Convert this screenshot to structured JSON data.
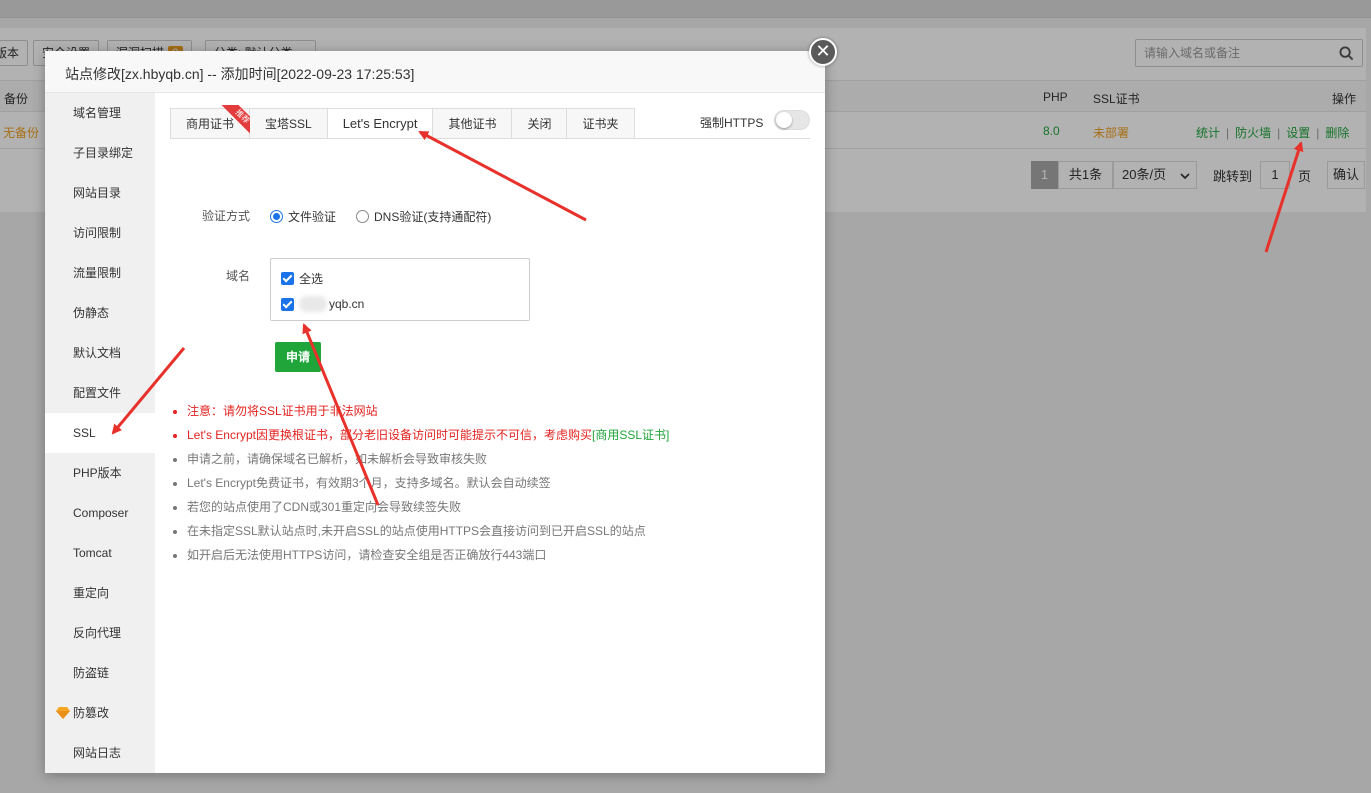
{
  "background": {
    "toolbar_buttons": [
      "版本",
      "安全设置",
      "漏洞扫描",
      "分类: 默认分类"
    ],
    "toolbar_badge": "0",
    "search_placeholder": "请输入域名或备注",
    "table": {
      "headers": {
        "backup": "备份",
        "php": "PHP",
        "ssl": "SSL证书",
        "ops": "操作"
      },
      "row": {
        "backup": "无备份",
        "php": "8.0",
        "ssl": "未部署",
        "ops": [
          "统计",
          "防火墙",
          "设置",
          "删除"
        ]
      }
    },
    "pager": {
      "current": "1",
      "total": "共1条",
      "per_page": "20条/页",
      "jump_label": "跳转到",
      "jump_value": "1",
      "page_unit": "页",
      "confirm": "确认"
    }
  },
  "modal": {
    "title": "站点修改[zx.hbyqb.cn] -- 添加时间[2022-09-23 17:25:53]",
    "close_glyph": "✕",
    "side_menu": [
      "域名管理",
      "子目录绑定",
      "网站目录",
      "访问限制",
      "流量限制",
      "伪静态",
      "默认文档",
      "配置文件",
      "SSL",
      "PHP版本",
      "Composer",
      "Tomcat",
      "重定向",
      "反向代理",
      "防盗链",
      "防篡改",
      "网站日志"
    ],
    "active_menu": "SSL",
    "tabs": [
      "商用证书",
      "宝塔SSL",
      "Let's Encrypt",
      "其他证书",
      "关闭",
      "证书夹"
    ],
    "active_tab": "Let's Encrypt",
    "tab_ribbon": "推荐",
    "force_https_label": "强制HTTPS",
    "force_https_on": false,
    "verify_label": "验证方式",
    "verify_options": [
      "文件验证",
      "DNS验证(支持通配符)"
    ],
    "verify_selected": "文件验证",
    "domain_label": "域名",
    "select_all_label": "全选",
    "domain_value": "yqb.cn",
    "apply_button": "申请",
    "notes": [
      "注意：请勿将SSL证书用于非法网站",
      "Let's Encrypt因更换根证书，部分老旧设备访问时可能提示不可信，考虑购买",
      "申请之前，请确保域名已解析，如未解析会导致审核失败",
      "Let's Encrypt免费证书，有效期3个月，支持多域名。默认会自动续签",
      "若您的站点使用了CDN或301重定向会导致续签失败",
      "在未指定SSL默认站点时,未开启SSL的站点使用HTTPS会直接访问到已开启SSL的站点",
      "如开启后无法使用HTTPS访问，请检查安全组是否正确放行443端口"
    ],
    "note_link": "[商用SSL证书]"
  },
  "colors": {
    "primary_green": "#20a53a",
    "warning_red": "#e3231f",
    "arrow_red": "#e8312a",
    "checkbox_blue": "#1a73e8"
  }
}
